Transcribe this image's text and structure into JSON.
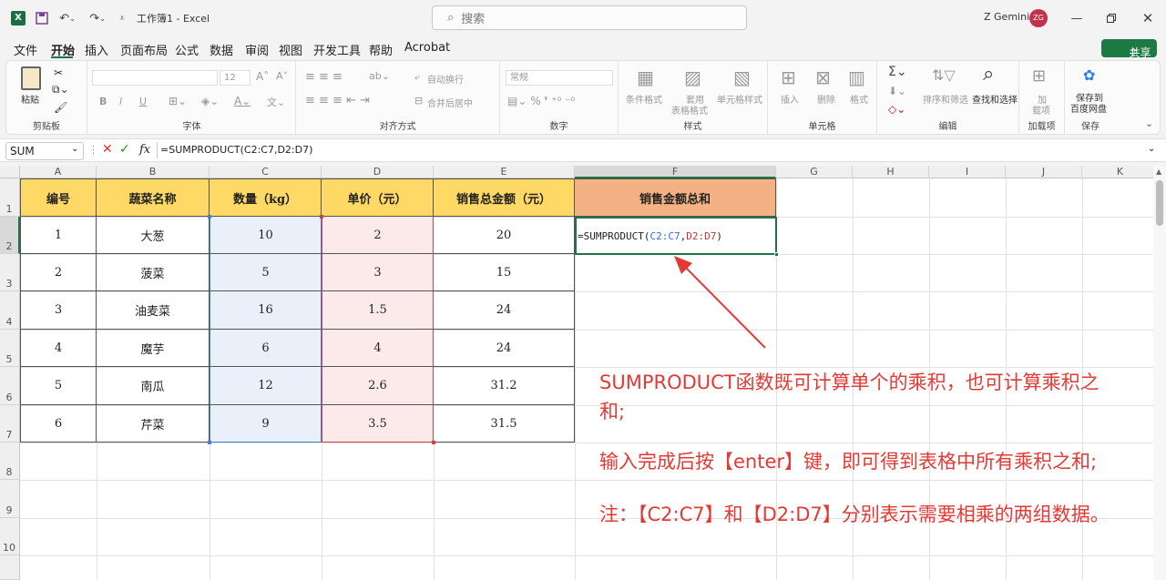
{
  "titlebar": {
    "file_name": "工作簿1 - Excel",
    "search_placeholder": "搜索",
    "user_name": "Z Gemini",
    "avatar_initials": "ZG"
  },
  "menu": {
    "items": [
      "文件",
      "开始",
      "插入",
      "页面布局",
      "公式",
      "数据",
      "审阅",
      "视图",
      "开发工具",
      "帮助",
      "Acrobat"
    ],
    "active": "开始",
    "share": "共享"
  },
  "ribbon": {
    "clipboard": {
      "paste": "粘贴",
      "label": "剪贴板"
    },
    "font": {
      "name": "",
      "size": "12",
      "bold": "B",
      "italic": "I",
      "underline": "U",
      "label": "字体"
    },
    "align": {
      "wrap": "自动换行",
      "merge": "合并后居中",
      "label": "对齐方式"
    },
    "number": {
      "format": "常规",
      "label": "数字"
    },
    "styles": {
      "conditional": "条件格式",
      "table_1": "套用",
      "table_2": "表格格式",
      "cell_style": "单元格样式",
      "label": "样式"
    },
    "cells": {
      "insert": "插入",
      "delete": "删除",
      "format": "格式",
      "label": "单元格"
    },
    "edit": {
      "sort": "排序和筛选",
      "find": "查找和选择",
      "label": "编辑"
    },
    "addins": {
      "line1": "加",
      "line2": "载项",
      "label": "加载项"
    },
    "save": {
      "line1": "保存到",
      "line2": "百度网盘",
      "label": "保存"
    }
  },
  "formula_bar": {
    "name_box": "SUM",
    "fx": "fx",
    "formula": "=SUMPRODUCT(C2:C7,D2:D7)"
  },
  "columns": [
    "A",
    "B",
    "C",
    "D",
    "E",
    "F",
    "G",
    "H",
    "I",
    "J",
    "K"
  ],
  "rows": [
    "1",
    "2",
    "3",
    "4",
    "5",
    "6",
    "7",
    "8",
    "9",
    "10"
  ],
  "table": {
    "headers": [
      "编号",
      "蔬菜名称",
      "数量（kg）",
      "单价（元）",
      "销售总金额（元）",
      "销售金额总和"
    ],
    "rows": [
      [
        "1",
        "大葱",
        "10",
        "2",
        "20"
      ],
      [
        "2",
        "菠菜",
        "5",
        "3",
        "15"
      ],
      [
        "3",
        "油麦菜",
        "16",
        "1.5",
        "24"
      ],
      [
        "4",
        "魔芋",
        "6",
        "4",
        "24"
      ],
      [
        "5",
        "南瓜",
        "12",
        "2.6",
        "31.2"
      ],
      [
        "6",
        "芹菜",
        "9",
        "3.5",
        "31.5"
      ]
    ],
    "f2_parts": {
      "pre": "=SUMPRODUCT(",
      "r1": "C2:C7",
      "sep": ",",
      "r2": "D2:D7",
      "post": ")"
    }
  },
  "annotations": {
    "line1a": "SUMPRODUCT函数既可计算单个的乘积，也可计算乘积之",
    "line1b": "和;",
    "line2": "输入完成后按【enter】键，即可得到表格中所有乘积之和;",
    "line3": "注：【C2:C7】和【D2:D7】分别表示需要相乘的两组数据。"
  },
  "colors": {
    "header_yellow": "#FFD966",
    "header_orange": "#F4B183",
    "qty_fill": "#EAF0FA",
    "price_fill": "#FCEAEA",
    "annotation_red": "#E53935",
    "accent_green": "#217346"
  }
}
